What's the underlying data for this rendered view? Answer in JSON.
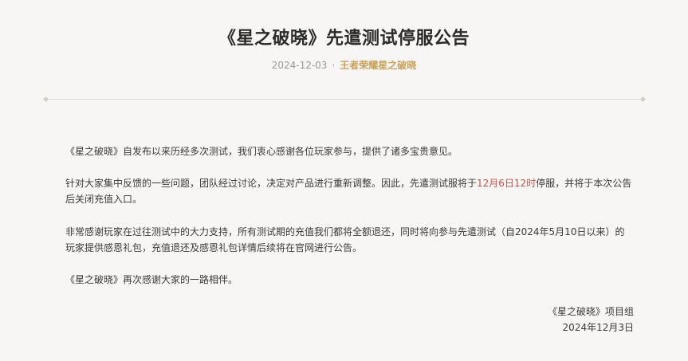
{
  "header": {
    "title": "《星之破晓》先遣测试停服公告",
    "date": "2024-12-03",
    "separator": "·",
    "author": "王者荣耀星之破晓"
  },
  "content": {
    "p1": "《星之破晓》自发布以来历经多次测试，我们衷心感谢各位玩家参与，提供了诸多宝贵意见。",
    "p2_before": "针对大家集中反馈的一些问题，团队经过讨论，决定对产品进行重新调整。因此，先遣测试服将于",
    "p2_highlight": "12月6日12时",
    "p2_after": "停服，并将于本次公告后关闭充值入口。",
    "p3": "非常感谢玩家在过往测试中的大力支持，所有测试期的充值我们都将全额退还，同时将向参与先遣测试（自2024年5月10日以来）的玩家提供感恩礼包，充值退还及感恩礼包详情后续将在官网进行公告。",
    "p4": "《星之破晓》再次感谢大家的一路相伴。"
  },
  "signature": {
    "team": "《星之破晓》项目组",
    "date": "2024年12月3日"
  },
  "colors": {
    "background": "#f7f6f4",
    "accent_gold": "#c9a15a",
    "highlight_red": "#c0544a"
  }
}
